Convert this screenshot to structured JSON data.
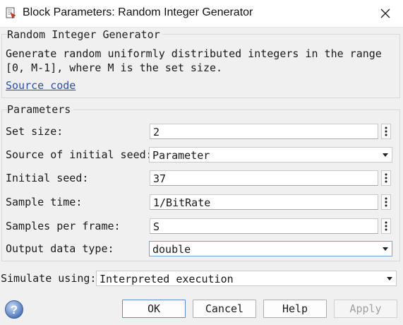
{
  "window": {
    "title": "Block Parameters: Random Integer Generator"
  },
  "block_group": {
    "title": "Random Integer Generator",
    "description": "Generate random uniformly distributed integers in the range [0, M-1], where M is the set size.",
    "source_link": "Source code"
  },
  "parameters": {
    "title": "Parameters",
    "set_size": {
      "label": "Set size:",
      "value": "2"
    },
    "seed_source": {
      "label": "Source of initial seed:",
      "value": "Parameter"
    },
    "initial_seed": {
      "label": "Initial seed:",
      "value": "37"
    },
    "sample_time": {
      "label": "Sample time:",
      "value": "1/BitRate"
    },
    "samples_per_frame": {
      "label": "Samples per frame:",
      "value": "S"
    },
    "output_type": {
      "label": "Output data type:",
      "value": "double"
    }
  },
  "simulate": {
    "label": "Simulate using:",
    "value": "Interpreted execution"
  },
  "buttons": {
    "ok": "OK",
    "cancel": "Cancel",
    "help": "Help",
    "apply": "Apply"
  },
  "icons": {
    "app": "block-parameters-icon",
    "close": "close-icon",
    "help": "help-question-icon",
    "menu": "vertical-ellipsis-icon"
  },
  "colors": {
    "link": "#2b4fa8",
    "focus_border": "#7aa2d6",
    "help_icon": "#4a74b8"
  }
}
